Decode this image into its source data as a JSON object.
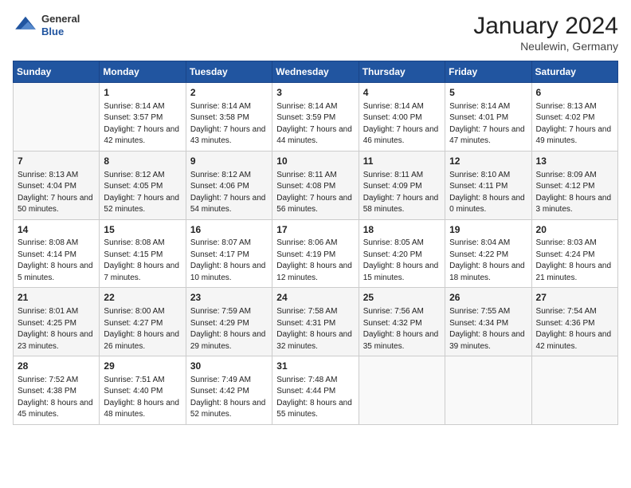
{
  "header": {
    "logo": {
      "general": "General",
      "blue": "Blue"
    },
    "title": "January 2024",
    "location": "Neulewin, Germany"
  },
  "weekdays": [
    "Sunday",
    "Monday",
    "Tuesday",
    "Wednesday",
    "Thursday",
    "Friday",
    "Saturday"
  ],
  "weeks": [
    [
      {
        "day": "",
        "sunrise": "",
        "sunset": "",
        "daylight": ""
      },
      {
        "day": "1",
        "sunrise": "Sunrise: 8:14 AM",
        "sunset": "Sunset: 3:57 PM",
        "daylight": "Daylight: 7 hours and 42 minutes."
      },
      {
        "day": "2",
        "sunrise": "Sunrise: 8:14 AM",
        "sunset": "Sunset: 3:58 PM",
        "daylight": "Daylight: 7 hours and 43 minutes."
      },
      {
        "day": "3",
        "sunrise": "Sunrise: 8:14 AM",
        "sunset": "Sunset: 3:59 PM",
        "daylight": "Daylight: 7 hours and 44 minutes."
      },
      {
        "day": "4",
        "sunrise": "Sunrise: 8:14 AM",
        "sunset": "Sunset: 4:00 PM",
        "daylight": "Daylight: 7 hours and 46 minutes."
      },
      {
        "day": "5",
        "sunrise": "Sunrise: 8:14 AM",
        "sunset": "Sunset: 4:01 PM",
        "daylight": "Daylight: 7 hours and 47 minutes."
      },
      {
        "day": "6",
        "sunrise": "Sunrise: 8:13 AM",
        "sunset": "Sunset: 4:02 PM",
        "daylight": "Daylight: 7 hours and 49 minutes."
      }
    ],
    [
      {
        "day": "7",
        "sunrise": "Sunrise: 8:13 AM",
        "sunset": "Sunset: 4:04 PM",
        "daylight": "Daylight: 7 hours and 50 minutes."
      },
      {
        "day": "8",
        "sunrise": "Sunrise: 8:12 AM",
        "sunset": "Sunset: 4:05 PM",
        "daylight": "Daylight: 7 hours and 52 minutes."
      },
      {
        "day": "9",
        "sunrise": "Sunrise: 8:12 AM",
        "sunset": "Sunset: 4:06 PM",
        "daylight": "Daylight: 7 hours and 54 minutes."
      },
      {
        "day": "10",
        "sunrise": "Sunrise: 8:11 AM",
        "sunset": "Sunset: 4:08 PM",
        "daylight": "Daylight: 7 hours and 56 minutes."
      },
      {
        "day": "11",
        "sunrise": "Sunrise: 8:11 AM",
        "sunset": "Sunset: 4:09 PM",
        "daylight": "Daylight: 7 hours and 58 minutes."
      },
      {
        "day": "12",
        "sunrise": "Sunrise: 8:10 AM",
        "sunset": "Sunset: 4:11 PM",
        "daylight": "Daylight: 8 hours and 0 minutes."
      },
      {
        "day": "13",
        "sunrise": "Sunrise: 8:09 AM",
        "sunset": "Sunset: 4:12 PM",
        "daylight": "Daylight: 8 hours and 3 minutes."
      }
    ],
    [
      {
        "day": "14",
        "sunrise": "Sunrise: 8:08 AM",
        "sunset": "Sunset: 4:14 PM",
        "daylight": "Daylight: 8 hours and 5 minutes."
      },
      {
        "day": "15",
        "sunrise": "Sunrise: 8:08 AM",
        "sunset": "Sunset: 4:15 PM",
        "daylight": "Daylight: 8 hours and 7 minutes."
      },
      {
        "day": "16",
        "sunrise": "Sunrise: 8:07 AM",
        "sunset": "Sunset: 4:17 PM",
        "daylight": "Daylight: 8 hours and 10 minutes."
      },
      {
        "day": "17",
        "sunrise": "Sunrise: 8:06 AM",
        "sunset": "Sunset: 4:19 PM",
        "daylight": "Daylight: 8 hours and 12 minutes."
      },
      {
        "day": "18",
        "sunrise": "Sunrise: 8:05 AM",
        "sunset": "Sunset: 4:20 PM",
        "daylight": "Daylight: 8 hours and 15 minutes."
      },
      {
        "day": "19",
        "sunrise": "Sunrise: 8:04 AM",
        "sunset": "Sunset: 4:22 PM",
        "daylight": "Daylight: 8 hours and 18 minutes."
      },
      {
        "day": "20",
        "sunrise": "Sunrise: 8:03 AM",
        "sunset": "Sunset: 4:24 PM",
        "daylight": "Daylight: 8 hours and 21 minutes."
      }
    ],
    [
      {
        "day": "21",
        "sunrise": "Sunrise: 8:01 AM",
        "sunset": "Sunset: 4:25 PM",
        "daylight": "Daylight: 8 hours and 23 minutes."
      },
      {
        "day": "22",
        "sunrise": "Sunrise: 8:00 AM",
        "sunset": "Sunset: 4:27 PM",
        "daylight": "Daylight: 8 hours and 26 minutes."
      },
      {
        "day": "23",
        "sunrise": "Sunrise: 7:59 AM",
        "sunset": "Sunset: 4:29 PM",
        "daylight": "Daylight: 8 hours and 29 minutes."
      },
      {
        "day": "24",
        "sunrise": "Sunrise: 7:58 AM",
        "sunset": "Sunset: 4:31 PM",
        "daylight": "Daylight: 8 hours and 32 minutes."
      },
      {
        "day": "25",
        "sunrise": "Sunrise: 7:56 AM",
        "sunset": "Sunset: 4:32 PM",
        "daylight": "Daylight: 8 hours and 35 minutes."
      },
      {
        "day": "26",
        "sunrise": "Sunrise: 7:55 AM",
        "sunset": "Sunset: 4:34 PM",
        "daylight": "Daylight: 8 hours and 39 minutes."
      },
      {
        "day": "27",
        "sunrise": "Sunrise: 7:54 AM",
        "sunset": "Sunset: 4:36 PM",
        "daylight": "Daylight: 8 hours and 42 minutes."
      }
    ],
    [
      {
        "day": "28",
        "sunrise": "Sunrise: 7:52 AM",
        "sunset": "Sunset: 4:38 PM",
        "daylight": "Daylight: 8 hours and 45 minutes."
      },
      {
        "day": "29",
        "sunrise": "Sunrise: 7:51 AM",
        "sunset": "Sunset: 4:40 PM",
        "daylight": "Daylight: 8 hours and 48 minutes."
      },
      {
        "day": "30",
        "sunrise": "Sunrise: 7:49 AM",
        "sunset": "Sunset: 4:42 PM",
        "daylight": "Daylight: 8 hours and 52 minutes."
      },
      {
        "day": "31",
        "sunrise": "Sunrise: 7:48 AM",
        "sunset": "Sunset: 4:44 PM",
        "daylight": "Daylight: 8 hours and 55 minutes."
      },
      {
        "day": "",
        "sunrise": "",
        "sunset": "",
        "daylight": ""
      },
      {
        "day": "",
        "sunrise": "",
        "sunset": "",
        "daylight": ""
      },
      {
        "day": "",
        "sunrise": "",
        "sunset": "",
        "daylight": ""
      }
    ]
  ]
}
